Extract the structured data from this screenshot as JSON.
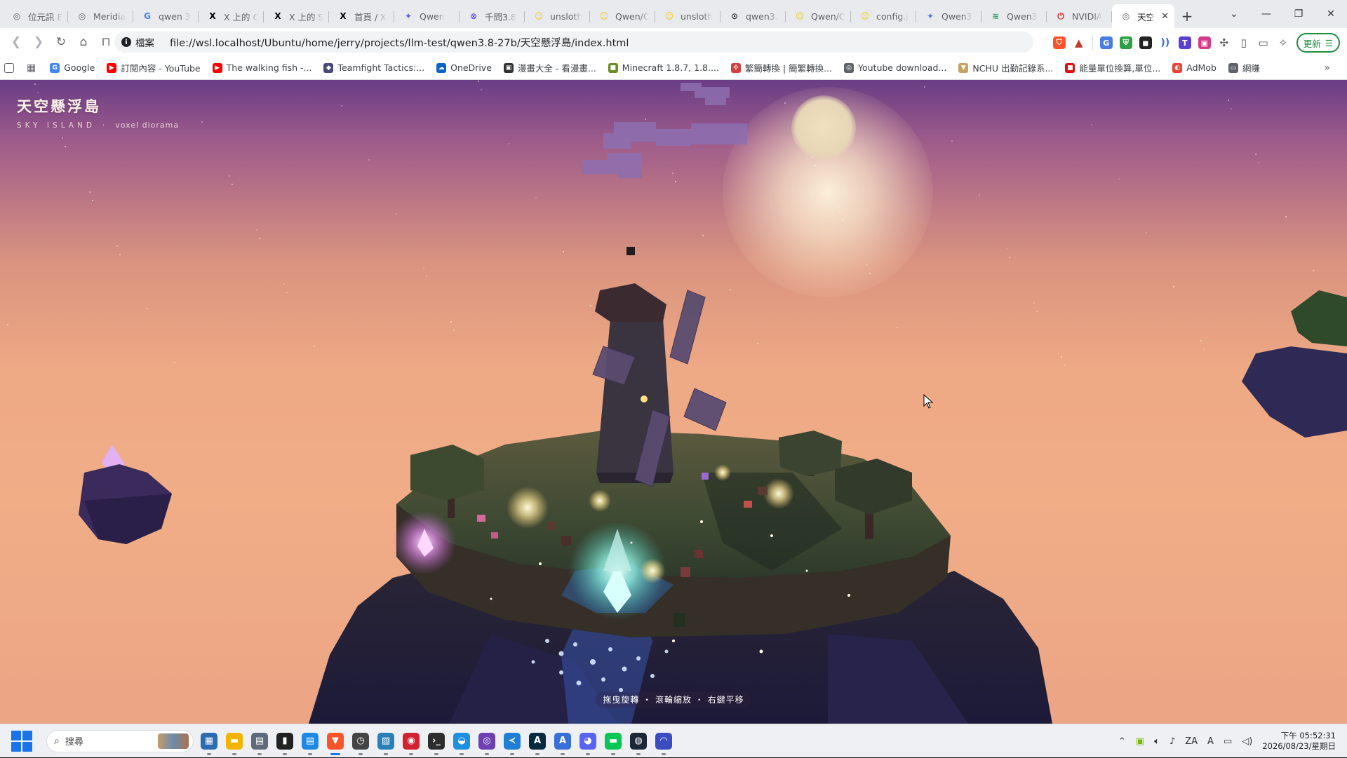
{
  "browser": {
    "tabs": [
      {
        "title": "位元訊 E",
        "icon": "globe-icon",
        "color": "#5f6368",
        "glyph": "◎"
      },
      {
        "title": "Meridia",
        "icon": "globe-icon",
        "color": "#5f6368",
        "glyph": "◎"
      },
      {
        "title": "qwen 3",
        "icon": "google-icon",
        "color": "#4285f4",
        "glyph": "G"
      },
      {
        "title": "X 上的 C",
        "icon": "x-icon",
        "color": "#000000",
        "glyph": "X"
      },
      {
        "title": "X 上的 S",
        "icon": "x-icon",
        "color": "#000000",
        "glyph": "X"
      },
      {
        "title": "首頁 / X",
        "icon": "x-icon",
        "color": "#000000",
        "glyph": "X"
      },
      {
        "title": "Qwen",
        "icon": "qwen-icon",
        "color": "#5b5bd6",
        "glyph": "✦"
      },
      {
        "title": "千問3.8",
        "icon": "qianwen-icon",
        "color": "#6b4de6",
        "glyph": "⊗"
      },
      {
        "title": "unsloth",
        "icon": "huggingface-icon",
        "color": "#f5c518",
        "glyph": "☺"
      },
      {
        "title": "Qwen/C",
        "icon": "huggingface-icon",
        "color": "#f5c518",
        "glyph": "☺"
      },
      {
        "title": "unsloth",
        "icon": "huggingface-icon",
        "color": "#f5c518",
        "glyph": "☺"
      },
      {
        "title": "qwen3.",
        "icon": "github-icon",
        "color": "#333333",
        "glyph": "⊙"
      },
      {
        "title": "Qwen/C",
        "icon": "huggingface-icon",
        "color": "#f5c518",
        "glyph": "☺"
      },
      {
        "title": "config.j",
        "icon": "huggingface-icon",
        "color": "#f5c518",
        "glyph": "☺"
      },
      {
        "title": "Qwen3",
        "icon": "gemini-icon",
        "color": "#4a7be0",
        "glyph": "✦"
      },
      {
        "title": "Qwen3",
        "icon": "doc-icon",
        "color": "#2d9c6b",
        "glyph": "≋"
      },
      {
        "title": "NVIDIA",
        "icon": "power-icon",
        "color": "#cc2222",
        "glyph": "⏻"
      },
      {
        "title": "天空",
        "icon": "globe-icon",
        "color": "#5f6368",
        "glyph": "◎",
        "active": true
      }
    ],
    "address": {
      "scheme_label": "檔案",
      "url": "file://wsl.localhost/Ubuntu/home/jerry/projects/llm-test/qwen3.8-27b/天空懸浮島/index.html"
    },
    "update_label": "更新",
    "bookmarks": [
      {
        "label": "Google",
        "icon": "google-icon",
        "color": "#4285f4",
        "glyph": "G"
      },
      {
        "label": "訂閱內容 - YouTube",
        "icon": "youtube-icon",
        "color": "#ff0000",
        "glyph": "▶"
      },
      {
        "label": "The walking fish -...",
        "icon": "youtube-icon",
        "color": "#ff0000",
        "glyph": "▶"
      },
      {
        "label": "Teamfight Tactics:...",
        "icon": "tft-icon",
        "color": "#4a4a7a",
        "glyph": "◆"
      },
      {
        "label": "OneDrive",
        "icon": "onedrive-icon",
        "color": "#0a64c8",
        "glyph": "☁"
      },
      {
        "label": "漫畫大全 - 看漫畫...",
        "icon": "manga-icon",
        "color": "#333333",
        "glyph": "▣"
      },
      {
        "label": "Minecraft 1.8.7, 1.8....",
        "icon": "minecraft-icon",
        "color": "#6b8e23",
        "glyph": "■"
      },
      {
        "label": "繁簡轉換 | 簡繁轉換...",
        "icon": "convert-icon",
        "color": "#d04040",
        "glyph": "✣"
      },
      {
        "label": "Youtube download...",
        "icon": "globe-icon",
        "color": "#5f6368",
        "glyph": "◎"
      },
      {
        "label": "NCHU 出勤記錄系...",
        "icon": "nchu-icon",
        "color": "#c8a060",
        "glyph": "▼"
      },
      {
        "label": "能量單位換算,單位...",
        "icon": "energy-icon",
        "color": "#dd1111",
        "glyph": "■"
      },
      {
        "label": "AdMob",
        "icon": "admob-icon",
        "color": "#ea4335",
        "glyph": "◐"
      },
      {
        "label": "網賺",
        "icon": "folder-icon",
        "color": "#5f6368",
        "glyph": "▭"
      }
    ]
  },
  "page": {
    "title": "天空懸浮島",
    "subtitle": "SKY ISLAND",
    "subtitle_tag": "voxel diorama",
    "hint": "拖曳旋轉 ・ 滾輪縮放 ・ 右鍵平移"
  },
  "taskbar": {
    "search_placeholder": "搜尋",
    "apps": [
      {
        "name": "widgets-app",
        "color": "#2b6cb0",
        "glyph": "▦"
      },
      {
        "name": "file-explorer-app",
        "color": "#f2b400",
        "glyph": "▬"
      },
      {
        "name": "calculator-app",
        "color": "#5f6b7a",
        "glyph": "▤"
      },
      {
        "name": "video-app",
        "color": "#222222",
        "glyph": "▮"
      },
      {
        "name": "notes-app",
        "color": "#1e88e5",
        "glyph": "▤"
      },
      {
        "name": "brave-browser-app",
        "color": "#fb542b",
        "glyph": "▼",
        "focused": true
      },
      {
        "name": "clock-app",
        "color": "#444444",
        "glyph": "◷"
      },
      {
        "name": "photos-app",
        "color": "#2a7fb8",
        "glyph": "▨"
      },
      {
        "name": "media-app",
        "color": "#d22230",
        "glyph": "◉"
      },
      {
        "name": "terminal-app",
        "color": "#2d2d2d",
        "glyph": "›_"
      },
      {
        "name": "edge-app",
        "color": "#1f8fe0",
        "glyph": "◒"
      },
      {
        "name": "obs-app",
        "color": "#6d3fb3",
        "glyph": "◎"
      },
      {
        "name": "vscode-app",
        "color": "#1f7fd8",
        "glyph": "≺"
      },
      {
        "name": "unreal-app",
        "color": "#0a2a40",
        "glyph": "A"
      },
      {
        "name": "arc-app",
        "color": "#3a6fd8",
        "glyph": "A"
      },
      {
        "name": "discord-app",
        "color": "#5865f2",
        "glyph": "◕"
      },
      {
        "name": "line-app",
        "color": "#06c755",
        "glyph": "▬"
      },
      {
        "name": "steam-app",
        "color": "#1b2838",
        "glyph": "◍"
      },
      {
        "name": "headset-app",
        "color": "#3b4cc0",
        "glyph": "◠"
      }
    ],
    "clock_time": "下午 05:52:31",
    "clock_date": "2026/08/23/星期日"
  }
}
